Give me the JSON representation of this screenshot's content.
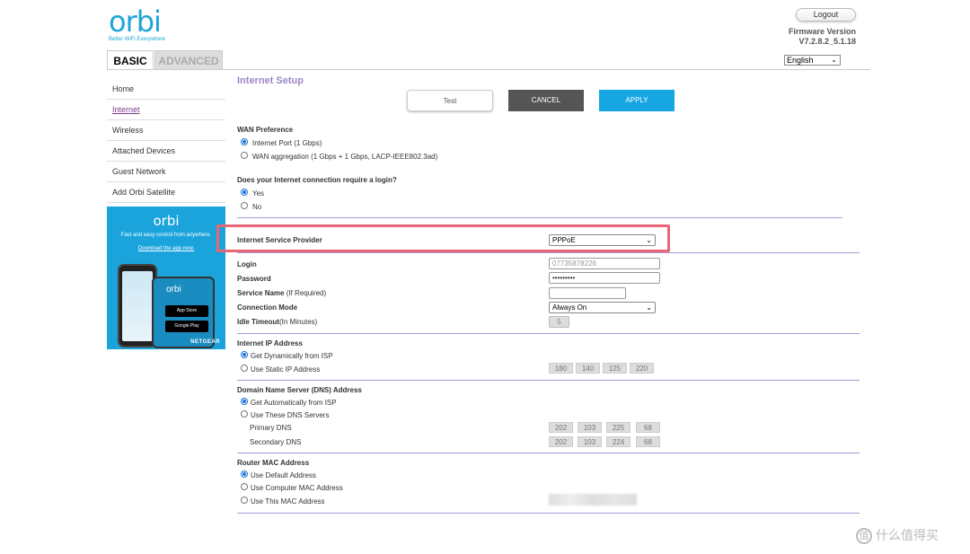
{
  "header": {
    "logo_word": "orbi",
    "logo_tagline": "Better WiFi Everywhere",
    "logout_label": "Logout",
    "firmware_label": "Firmware Version",
    "firmware_value": "V7.2.8.2_5.1.18",
    "language": "English"
  },
  "tabs": {
    "basic": "BASIC",
    "advanced": "ADVANCED"
  },
  "sidebar": {
    "items": [
      "Home",
      "Internet",
      "Wireless",
      "Attached Devices",
      "Guest Network",
      "Add Orbi Satellite"
    ],
    "active": "Internet"
  },
  "promo": {
    "logo": "orbi",
    "text": "Fast and easy control from anywhere.",
    "link": "Download the app now.",
    "app_store": "App Store",
    "google_play": "Google Play",
    "brand": "NETGEAR"
  },
  "main": {
    "title": "Internet Setup",
    "buttons": {
      "test": "Test",
      "cancel": "CANCEL",
      "apply": "APPLY"
    },
    "wan_pref": {
      "heading": "WAN Preference",
      "opt1": "Internet Port (1 Gbps)",
      "opt2": "WAN aggregation (1 Gbps + 1 Gbps, LACP-IEEE802.3ad)"
    },
    "login_req": {
      "heading": "Does your Internet connection require a login?",
      "yes": "Yes",
      "no": "No"
    },
    "isp": {
      "label": "Internet Service Provider",
      "value": "PPPoE"
    },
    "fields": {
      "login_label": "Login",
      "login_value": "07735878226",
      "password_label": "Password",
      "password_value": "•••••••••",
      "service_label": "Service Name",
      "service_hint": " (If Required)",
      "conn_label": "Connection Mode",
      "conn_value": "Always On",
      "idle_label": "Idle Timeout",
      "idle_hint": "(In Minutes)",
      "idle_value": "5"
    },
    "ip": {
      "heading": "Internet IP Address",
      "dynamic": "Get Dynamically from ISP",
      "static": "Use Static IP Address",
      "octets": [
        "180",
        "140",
        "125",
        "220"
      ]
    },
    "dns": {
      "heading": "Domain Name Server (DNS) Address",
      "auto": "Get Automatically from ISP",
      "manual": "Use These DNS Servers",
      "primary_label": "Primary DNS",
      "primary": [
        "202",
        "103",
        "225",
        "68"
      ],
      "secondary_label": "Secondary DNS",
      "secondary": [
        "202",
        "103",
        "224",
        "68"
      ]
    },
    "mac": {
      "heading": "Router MAC Address",
      "default": "Use Default Address",
      "computer": "Use Computer MAC Address",
      "this": "Use This MAC Address"
    }
  },
  "watermark": "什么值得买"
}
